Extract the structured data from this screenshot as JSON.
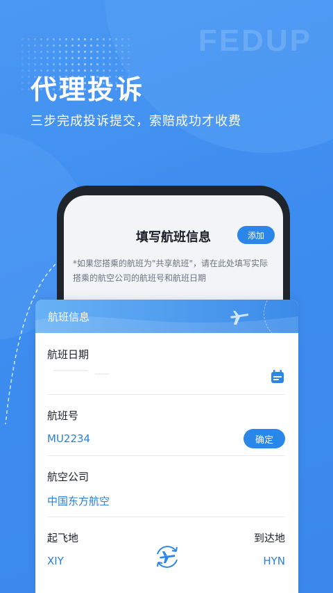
{
  "banner": {
    "watermark": "FEDUP",
    "title": "代理投诉",
    "subtitle": "三步完成投诉提交，索赔成功才收费"
  },
  "screen": {
    "title": "填写航班信息",
    "add_label": "添加",
    "notice": "*如果您搭乘的航班为\"共享航班\"，请在此处填写实际搭乘的航空公司的航班号和航班日期"
  },
  "card": {
    "header": "航班信息",
    "fields": {
      "date_label": "航班日期",
      "flight_label": "航班号",
      "flight_value": "MU2234",
      "confirm_label": "确定",
      "airline_label": "航空公司",
      "airline_value": "中国东方航空",
      "depart_label": "起飞地",
      "depart_value": "XIY",
      "arrive_label": "到达地",
      "arrive_value": "HYN"
    }
  },
  "icons": {
    "calendar": "calendar-icon",
    "swap": "swap-plane-icon",
    "plane": "plane-icon"
  },
  "colors": {
    "background": "#3f8ff0",
    "accent": "#2a86e8",
    "value_text": "#2a7fd6"
  }
}
